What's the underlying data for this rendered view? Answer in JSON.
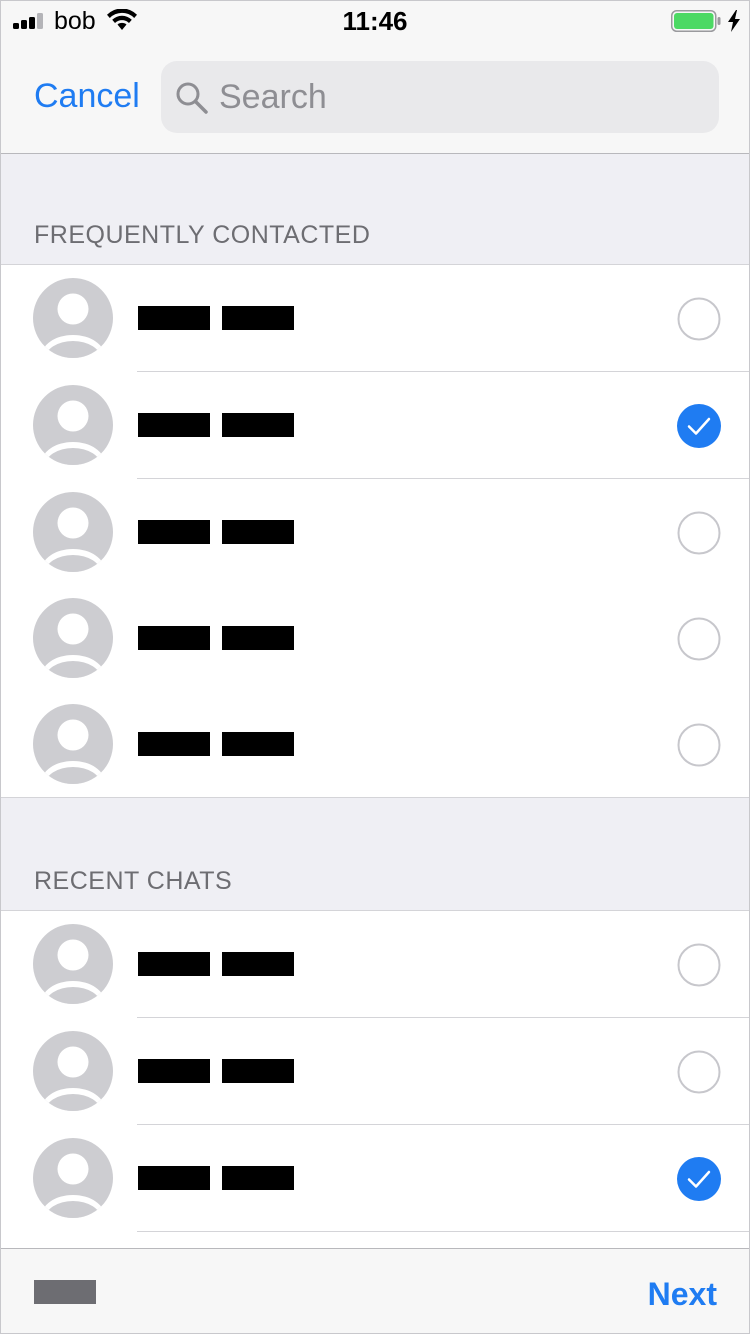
{
  "status_bar": {
    "carrier": "bob",
    "time": "11:46",
    "signal_bars_filled": 3,
    "battery_color": "#4cd964"
  },
  "nav": {
    "cancel_label": "Cancel",
    "search_placeholder": "Search"
  },
  "sections": [
    {
      "title": "FREQUENTLY CONTACTED",
      "contacts": [
        {
          "name_redacted": true,
          "selected": false
        },
        {
          "name_redacted": true,
          "selected": true
        },
        {
          "name_redacted": true,
          "selected": false
        },
        {
          "name_redacted": true,
          "selected": false
        },
        {
          "name_redacted": true,
          "selected": false
        }
      ]
    },
    {
      "title": "RECENT CHATS",
      "contacts": [
        {
          "name_redacted": true,
          "selected": false
        },
        {
          "name_redacted": true,
          "selected": false
        },
        {
          "name_redacted": true,
          "selected": true
        }
      ]
    }
  ],
  "toolbar": {
    "next_label": "Next"
  },
  "colors": {
    "accent": "#1f7cf2",
    "checkmark_fill": "#1f7cf2",
    "section_background": "#efeff4"
  },
  "icons": {
    "avatar": "person-placeholder-icon",
    "unselected": "empty-circle-icon",
    "selected": "checkmark-circle-icon",
    "search": "magnifier-icon"
  }
}
